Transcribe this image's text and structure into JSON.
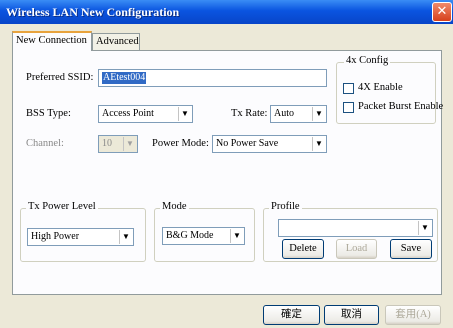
{
  "window": {
    "title": "Wireless LAN New Configuration"
  },
  "tabs": [
    {
      "label": "New Connection"
    },
    {
      "label": "Advanced"
    }
  ],
  "form": {
    "ssid_label": "Preferred SSID:",
    "ssid_value": "AEtest004",
    "bss_label": "BSS Type:",
    "bss_value": "Access Point",
    "txrate_label": "Tx Rate:",
    "txrate_value": "Auto",
    "channel_label": "Channel:",
    "channel_value": "10",
    "power_mode_label": "Power Mode:",
    "power_mode_value": "No Power Save"
  },
  "config4x": {
    "legend": "4x Config",
    "enable_label": "4X Enable",
    "enable_checked": false,
    "burst_label": "Packet Burst Enable",
    "burst_checked": false
  },
  "txpower": {
    "legend": "Tx Power Level",
    "value": "High Power"
  },
  "mode": {
    "legend": "Mode",
    "value": "B&G Mode"
  },
  "profile": {
    "legend": "Profile",
    "value": "",
    "delete_label": "Delete",
    "load_label": "Load",
    "save_label": "Save"
  },
  "footer": {
    "ok_label": "確定",
    "cancel_label": "取消",
    "apply_label": "套用(A)"
  }
}
